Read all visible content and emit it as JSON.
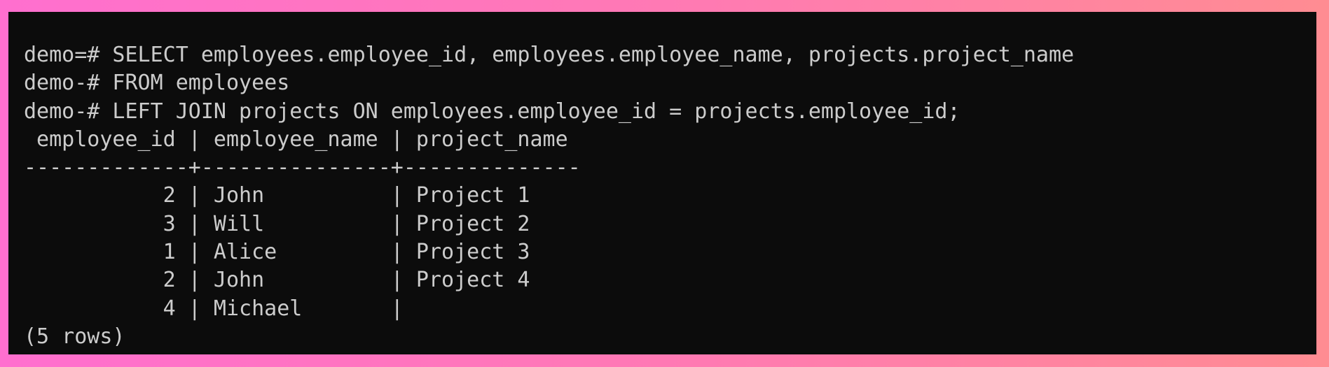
{
  "terminal": {
    "lines": [
      "demo=# SELECT employees.employee_id, employees.employee_name, projects.project_name",
      "demo-# FROM employees",
      "demo-# LEFT JOIN projects ON employees.employee_id = projects.employee_id;",
      " employee_id | employee_name | project_name",
      "-------------+---------------+--------------",
      "           2 | John          | Project 1",
      "           3 | Will          | Project 2",
      "           1 | Alice         | Project 3",
      "           2 | John          | Project 4",
      "           4 | Michael       |",
      "(5 rows)"
    ],
    "colors": {
      "background": "#0c0c0c",
      "text": "#cccccc"
    }
  }
}
